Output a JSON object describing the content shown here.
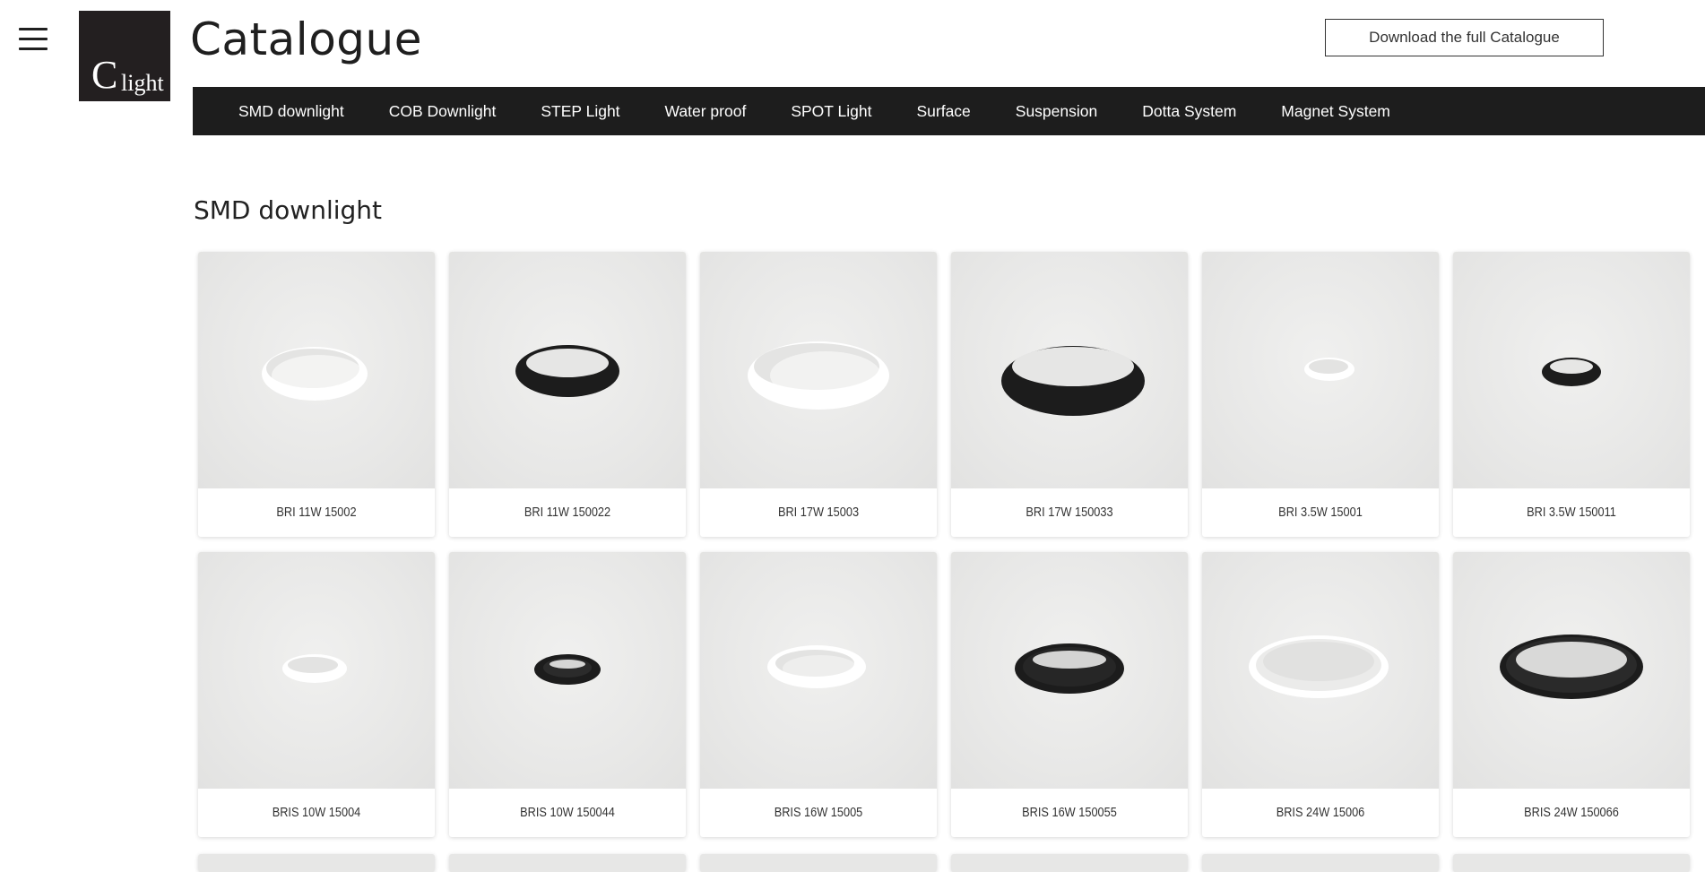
{
  "header": {
    "menu_icon": "hamburger-menu-icon",
    "logo_c": "C",
    "logo_light": "light",
    "title": "Catalogue",
    "download_label": "Download the full Catalogue"
  },
  "nav": {
    "items": [
      "SMD downlight",
      "COB Downlight",
      "STEP Light",
      "Water proof",
      "SPOT Light",
      "Surface",
      "Suspension",
      "Dotta System",
      "Magnet System"
    ]
  },
  "section": {
    "title": "SMD downlight"
  },
  "products": [
    {
      "name": "BRI 11W 15002",
      "color": "white"
    },
    {
      "name": "BRI 11W 150022",
      "color": "black"
    },
    {
      "name": "BRI 17W 15003",
      "color": "white"
    },
    {
      "name": "BRI 17W 150033",
      "color": "black"
    },
    {
      "name": "BRI 3.5W 15001",
      "color": "white"
    },
    {
      "name": "BRI 3.5W 150011",
      "color": "black"
    },
    {
      "name": "BRIS 10W 15004",
      "color": "white"
    },
    {
      "name": "BRIS 10W 150044",
      "color": "black"
    },
    {
      "name": "BRIS 16W 15005",
      "color": "white"
    },
    {
      "name": "BRIS 16W 150055",
      "color": "black"
    },
    {
      "name": "BRIS 24W 15006",
      "color": "white"
    },
    {
      "name": "BRIS 24W 150066",
      "color": "black"
    }
  ],
  "colors": {
    "nav_bg": "#1d1d1d",
    "logo_bg": "#231f20",
    "fixture_black": "#1c1c1c",
    "fixture_white": "#f7f7f6"
  }
}
